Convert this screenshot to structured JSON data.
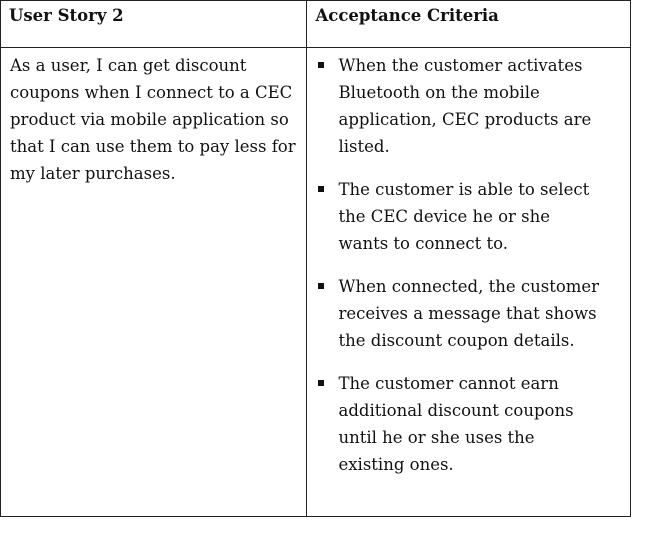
{
  "table": {
    "headers": {
      "story": "User Story 2",
      "criteria": "Acceptance Criteria"
    },
    "story_text": "As a user, I can get discount coupons when I connect to a CEC product via mobile application so that I can use them to pay less for my later purchases.",
    "criteria": [
      "When the customer activates Bluetooth on the mobile application, CEC products are listed.",
      "The customer is able to select the CEC device he or she wants to connect to.",
      "When connected, the customer receives a message that shows the discount coupon details.",
      "The customer cannot earn additional discount coupons until he or she uses the existing ones."
    ]
  }
}
